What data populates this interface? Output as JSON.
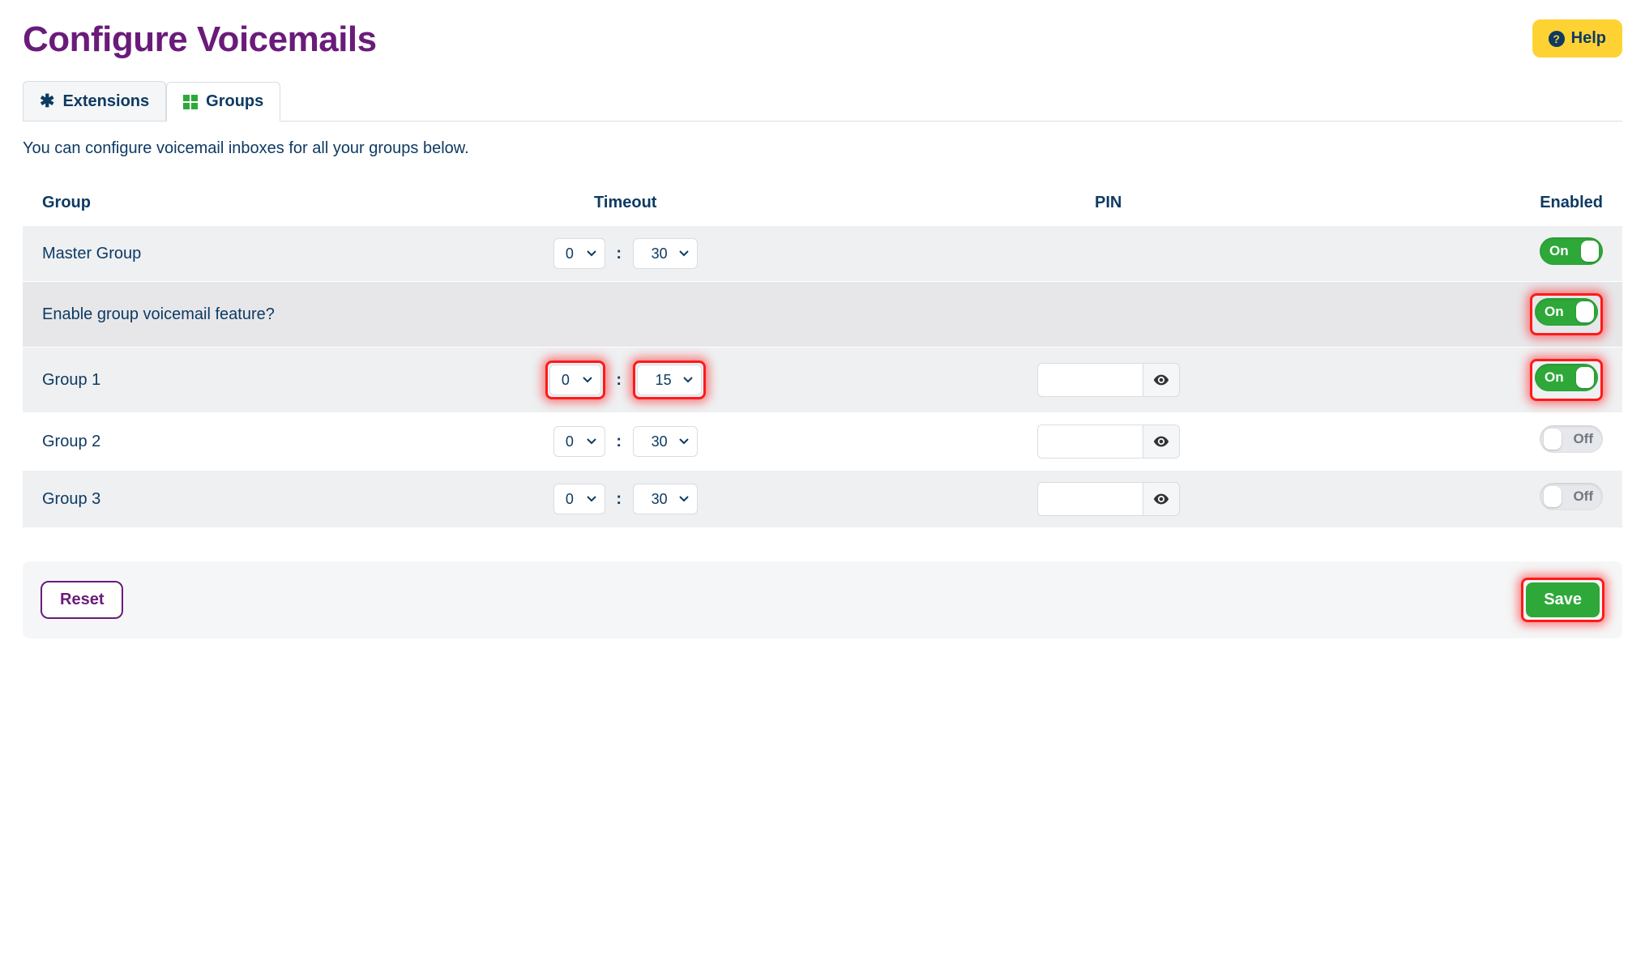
{
  "page_title": "Configure Voicemails",
  "help_label": "Help",
  "tabs": {
    "extensions": "Extensions",
    "groups": "Groups"
  },
  "intro": "You can configure voicemail inboxes for all your groups below.",
  "columns": {
    "group": "Group",
    "timeout": "Timeout",
    "pin": "PIN",
    "enabled": "Enabled"
  },
  "toggle_labels": {
    "on": "On",
    "off": "Off"
  },
  "rows": {
    "master": {
      "name": "Master Group",
      "min": "0",
      "sec": "30",
      "pin": "",
      "has_pin": false,
      "enabled": true,
      "highlight_timeout": false,
      "highlight_toggle": false
    },
    "feature": {
      "name": "Enable group voicemail feature?",
      "enabled": true,
      "highlight_toggle": true
    },
    "group1": {
      "name": "Group 1",
      "min": "0",
      "sec": "15",
      "pin": "",
      "has_pin": true,
      "enabled": true,
      "highlight_timeout": true,
      "highlight_toggle": true
    },
    "group2": {
      "name": "Group 2",
      "min": "0",
      "sec": "30",
      "pin": "",
      "has_pin": true,
      "enabled": false,
      "highlight_timeout": false,
      "highlight_toggle": false
    },
    "group3": {
      "name": "Group 3",
      "min": "0",
      "sec": "30",
      "pin": "",
      "has_pin": true,
      "enabled": false,
      "highlight_timeout": false,
      "highlight_toggle": false
    }
  },
  "footer": {
    "reset": "Reset",
    "save": "Save",
    "highlight_save": true
  }
}
